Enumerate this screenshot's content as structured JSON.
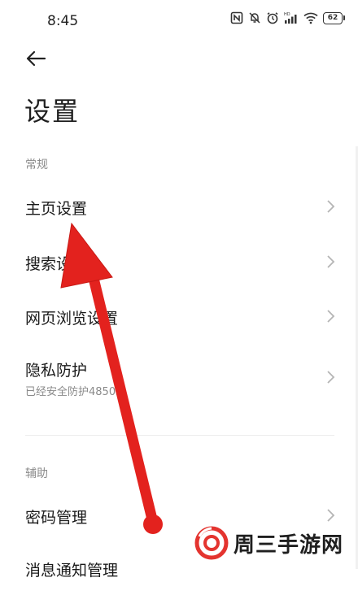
{
  "status_bar": {
    "time": "8:45",
    "battery": "62"
  },
  "header": {
    "title": "设置"
  },
  "sections": [
    {
      "label": "常规",
      "items": [
        {
          "label": "主页设置"
        },
        {
          "label": "搜索设置"
        },
        {
          "label": "网页浏览设置"
        },
        {
          "label": "隐私防护",
          "subtitle": "已经安全防护4850次"
        }
      ]
    },
    {
      "label": "辅助",
      "items": [
        {
          "label": "密码管理"
        },
        {
          "label": "消息通知管理"
        }
      ]
    }
  ],
  "watermark": {
    "text": "周三手游网"
  },
  "colors": {
    "annotation_arrow": "#e3221e",
    "watermark_logo": "#e4342f"
  }
}
